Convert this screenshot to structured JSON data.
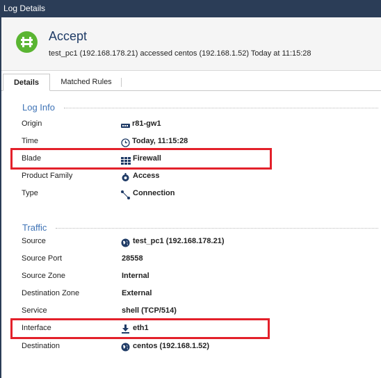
{
  "window": {
    "title": "Log Details"
  },
  "header": {
    "action": "Accept",
    "description": "test_pc1 (192.168.178.21) accessed centos (192.168.1.52) Today at  11:15:28",
    "icon": "accept-icon",
    "icon_color": "#5ab532"
  },
  "tabs": [
    {
      "label": "Details",
      "active": true
    },
    {
      "label": "Matched Rules",
      "active": false
    }
  ],
  "log_info": {
    "title": "Log Info",
    "rows": [
      {
        "label": "Origin",
        "value": "r81-gw1",
        "icon": "gateway-icon"
      },
      {
        "label": "Time",
        "value": "Today, 11:15:28",
        "icon": "clock-icon"
      },
      {
        "label": "Blade",
        "value": "Firewall",
        "icon": "firewall-icon"
      },
      {
        "label": "Product Family",
        "value": "Access",
        "icon": "access-icon"
      },
      {
        "label": "Type",
        "value": "Connection",
        "icon": "connection-icon"
      }
    ]
  },
  "traffic": {
    "title": "Traffic",
    "rows": [
      {
        "label": "Source",
        "value": "test_pc1 (192.168.178.21)",
        "icon": "globe-icon"
      },
      {
        "label": "Source Port",
        "value": "28558"
      },
      {
        "label": "Source Zone",
        "value": "Internal"
      },
      {
        "label": "Destination Zone",
        "value": "External"
      },
      {
        "label": "Service",
        "value": "shell (TCP/514)"
      },
      {
        "label": "Interface",
        "value": "eth1",
        "icon": "download-arrow-icon"
      },
      {
        "label": "Destination",
        "value": "centos (192.168.1.52)",
        "icon": "globe-icon"
      }
    ]
  },
  "colors": {
    "titlebar": "#2b3d57",
    "section_title": "#3e73b6",
    "highlight": "#e3202a"
  }
}
